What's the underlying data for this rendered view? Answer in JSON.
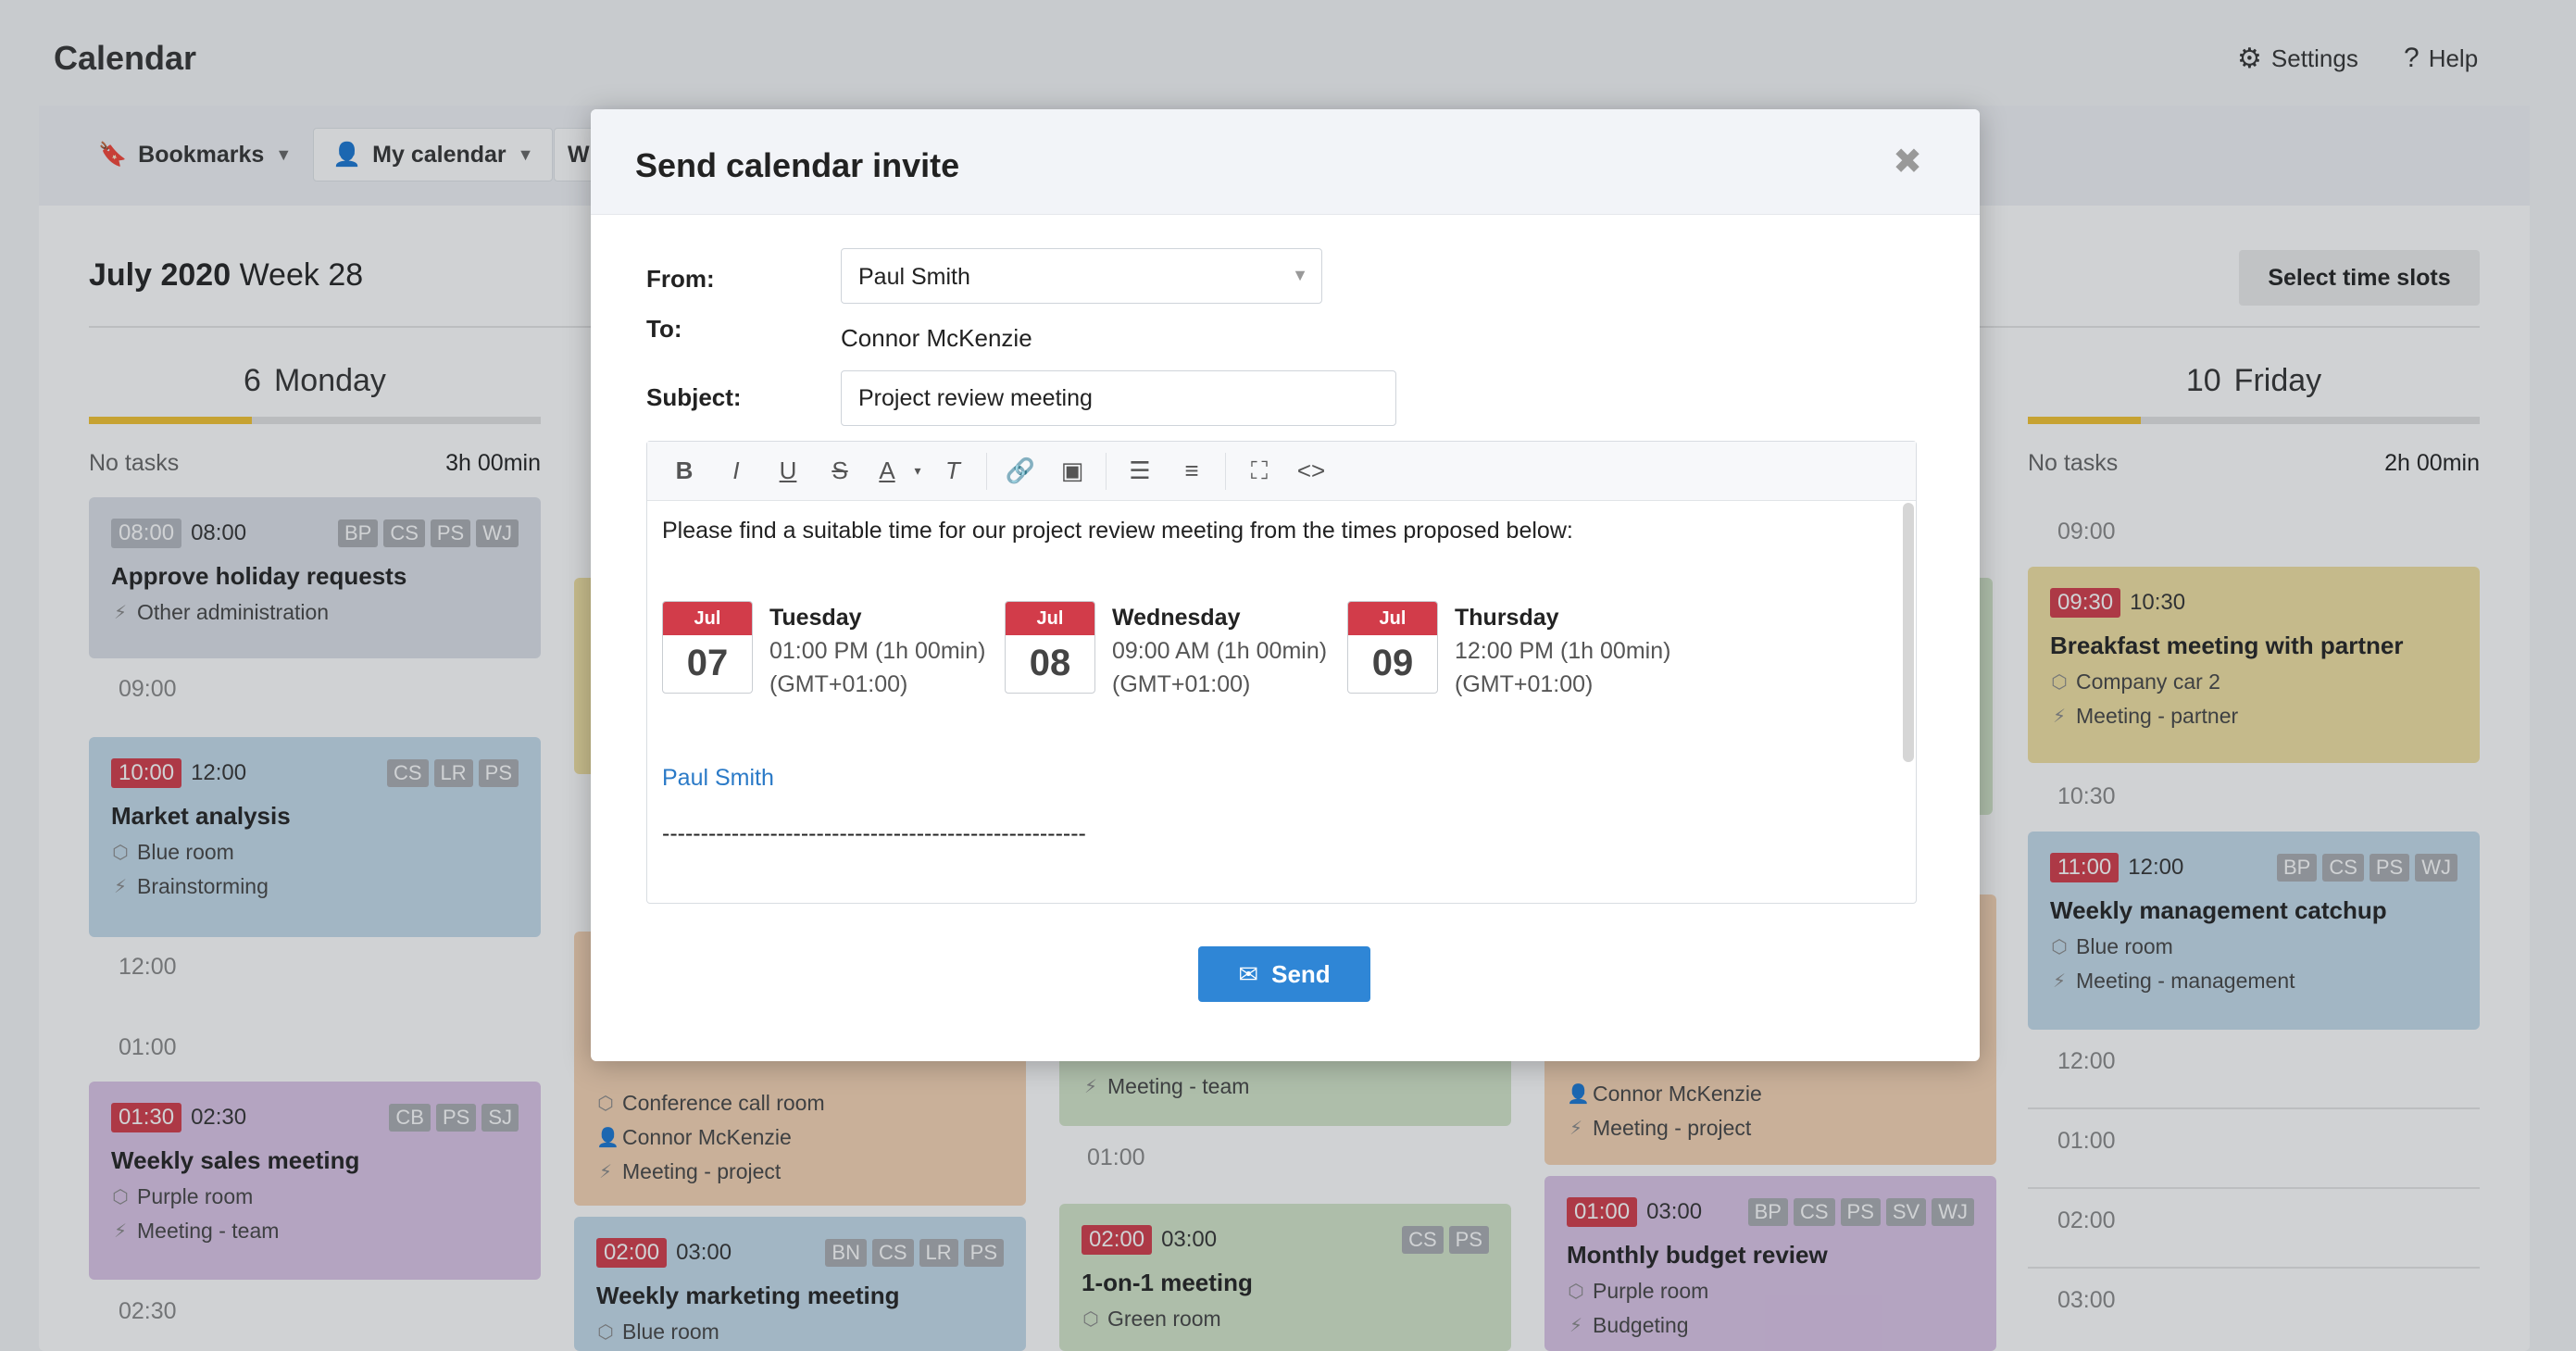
{
  "app": {
    "title": "Calendar",
    "settings_label": "Settings",
    "help_label": "Help"
  },
  "toolbar": {
    "bookmarks_label": "Bookmarks",
    "my_calendar_label": "My calendar",
    "partial_label": "W"
  },
  "week": {
    "month_year": "July 2020",
    "week_label": "Week 28",
    "select_slots_label": "Select time slots"
  },
  "days": [
    {
      "num": "6",
      "name": "Monday",
      "tasks": "No tasks",
      "duration": "3h 00min",
      "progress": 0.36,
      "events": [
        {
          "start": "08:00",
          "start_style": "grey",
          "end": "08:00",
          "tags": [
            "BP",
            "CS",
            "PS",
            "WJ"
          ],
          "title": "Approve holiday requests",
          "meta": [
            {
              "icon": "bolt-icon",
              "text": "Other administration"
            }
          ],
          "color": "grey"
        },
        {
          "start": "10:00",
          "start_style": "red",
          "end": "12:00",
          "tags": [
            "CS",
            "LR",
            "PS"
          ],
          "title": "Market analysis",
          "meta": [
            {
              "icon": "cube-icon",
              "text": "Blue room"
            },
            {
              "icon": "bolt-icon",
              "text": "Brainstorming"
            }
          ],
          "color": "blue"
        },
        {
          "start": "01:30",
          "start_style": "red",
          "end": "02:30",
          "tags": [
            "CB",
            "PS",
            "SJ"
          ],
          "title": "Weekly sales meeting",
          "meta": [
            {
              "icon": "cube-icon",
              "text": "Purple room"
            },
            {
              "icon": "bolt-icon",
              "text": "Meeting - team"
            }
          ],
          "color": "purple"
        }
      ],
      "times": [
        "09:00",
        "12:00",
        "01:00",
        "02:30"
      ]
    },
    {
      "label": "partial",
      "events": [
        {
          "start": "02:00",
          "end": "03:00",
          "tags": [
            "BN",
            "CS",
            "LR",
            "PS"
          ],
          "title": "Weekly marketing meeting",
          "meta": [
            {
              "icon": "cube-icon",
              "text": "Blue room"
            }
          ],
          "color": "blue"
        }
      ],
      "orange_meta": [
        {
          "icon": "cube-icon",
          "text": "Conference call room"
        },
        {
          "icon": "person-icon",
          "text": "Connor McKenzie"
        },
        {
          "icon": "bolt-icon",
          "text": "Meeting - project"
        }
      ]
    },
    {
      "label": "partial",
      "green_meta": [
        {
          "icon": "bolt-icon",
          "text": "Meeting - team"
        }
      ],
      "time": "01:00",
      "events": [
        {
          "start": "02:00",
          "end": "03:00",
          "tags": [
            "CS",
            "PS"
          ],
          "title": "1-on-1 meeting",
          "meta": [
            {
              "icon": "cube-icon",
              "text": "Green room"
            }
          ],
          "color": "green"
        }
      ]
    },
    {
      "label": "partial",
      "orange_meta": [
        {
          "icon": "person-icon",
          "text": "Connor McKenzie"
        },
        {
          "icon": "bolt-icon",
          "text": "Meeting - project"
        }
      ],
      "events": [
        {
          "start": "01:00",
          "end": "03:00",
          "tags": [
            "BP",
            "CS",
            "PS",
            "SV",
            "WJ"
          ],
          "title": "Monthly budget review",
          "meta": [
            {
              "icon": "cube-icon",
              "text": "Purple room"
            },
            {
              "icon": "bolt-icon",
              "text": "Budgeting"
            }
          ],
          "color": "purple"
        }
      ],
      "hidden_duration_suffix": "in"
    },
    {
      "num": "10",
      "name": "Friday",
      "tasks": "No tasks",
      "duration": "2h 00min",
      "progress": 0.25,
      "events": [
        {
          "start": "09:30",
          "end": "10:30",
          "tags": [],
          "title": "Breakfast meeting with partner",
          "meta": [
            {
              "icon": "cube-icon",
              "text": "Company car 2"
            },
            {
              "icon": "bolt-icon",
              "text": "Meeting - partner"
            }
          ],
          "color": "yellow"
        },
        {
          "start": "11:00",
          "end": "12:00",
          "tags": [
            "BP",
            "CS",
            "PS",
            "WJ"
          ],
          "title": "Weekly management catchup",
          "meta": [
            {
              "icon": "cube-icon",
              "text": "Blue room"
            },
            {
              "icon": "bolt-icon",
              "text": "Meeting - management"
            }
          ],
          "color": "blue"
        }
      ],
      "times": [
        "09:00",
        "10:30",
        "12:00",
        "01:00",
        "02:00",
        "03:00"
      ]
    }
  ],
  "modal": {
    "title": "Send calendar invite",
    "from_label": "From:",
    "from_value": "Paul Smith",
    "to_label": "To:",
    "to_value": "Connor McKenzie",
    "subject_label": "Subject:",
    "subject_value": "Project review meeting",
    "body_intro": "Please find a suitable time for our project review meeting from the times proposed below:",
    "proposals": [
      {
        "month": "Jul",
        "day": "07",
        "weekday": "Tuesday",
        "time": "01:00 PM (1h 00min)",
        "tz": "(GMT+01:00)"
      },
      {
        "month": "Jul",
        "day": "08",
        "weekday": "Wednesday",
        "time": "09:00 AM (1h 00min)",
        "tz": "(GMT+01:00)"
      },
      {
        "month": "Jul",
        "day": "09",
        "weekday": "Thursday",
        "time": "12:00 PM (1h 00min)",
        "tz": "(GMT+01:00)"
      }
    ],
    "signature": "Paul Smith",
    "separator": "-------------------------------------------------------",
    "send_label": "Send"
  }
}
